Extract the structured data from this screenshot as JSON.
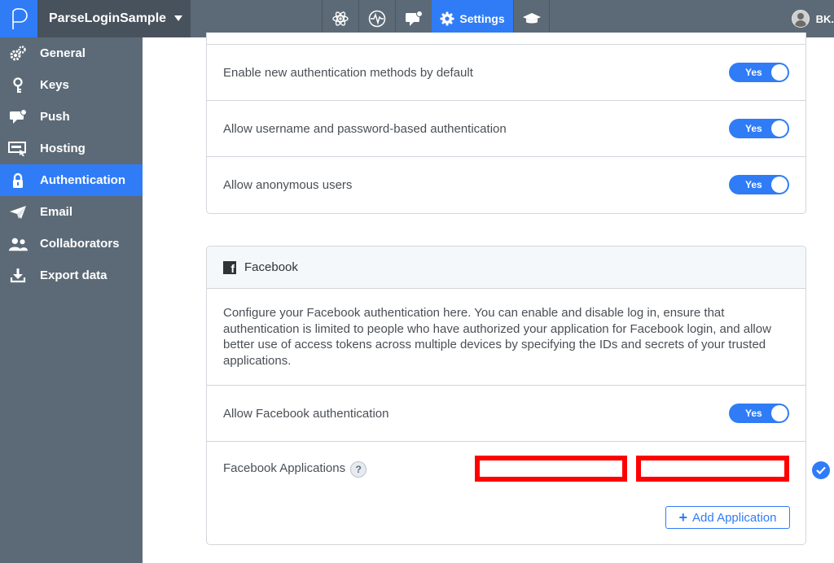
{
  "topbar": {
    "logo_letter": "P",
    "app_name": "ParseLoginSample",
    "nav": [
      {
        "icon": "atom-icon"
      },
      {
        "icon": "analytics-pulse-icon"
      },
      {
        "icon": "push-message-icon"
      },
      {
        "icon": "settings-gear-icon",
        "label": "Settings"
      },
      {
        "icon": "graduation-cap-icon"
      }
    ],
    "user_name": "BK."
  },
  "sidebar": {
    "items": [
      {
        "label": "General",
        "icon": "gears-icon"
      },
      {
        "label": "Keys",
        "icon": "key-icon"
      },
      {
        "label": "Push",
        "icon": "push-message-icon"
      },
      {
        "label": "Hosting",
        "icon": "hosting-icon"
      },
      {
        "label": "Authentication",
        "icon": "lock-icon",
        "active": true
      },
      {
        "label": "Email",
        "icon": "paper-plane-icon"
      },
      {
        "label": "Collaborators",
        "icon": "users-icon"
      },
      {
        "label": "Export data",
        "icon": "download-icon"
      }
    ]
  },
  "auth_settings": {
    "rows": [
      {
        "label": "Enable new authentication methods by default",
        "toggle": "Yes"
      },
      {
        "label": "Allow username and password-based authentication",
        "toggle": "Yes"
      },
      {
        "label": "Allow anonymous users",
        "toggle": "Yes"
      }
    ]
  },
  "facebook": {
    "title": "Facebook",
    "description": "Configure your Facebook authentication here. You can enable and disable log in, ensure that authentication is limited to people who have authorized your application for Facebook login, and allow better use of access tokens across multiple devices by specifying the IDs and secrets of your trusted applications.",
    "allow_label": "Allow Facebook authentication",
    "allow_toggle": "Yes",
    "apps_label": "Facebook Applications",
    "help_symbol": "?",
    "add_button": "Add Application",
    "add_symbol": "+"
  },
  "colors": {
    "accent": "#2f7cf6",
    "sidebar": "#5c6a77",
    "redaction": "#ff0000"
  }
}
